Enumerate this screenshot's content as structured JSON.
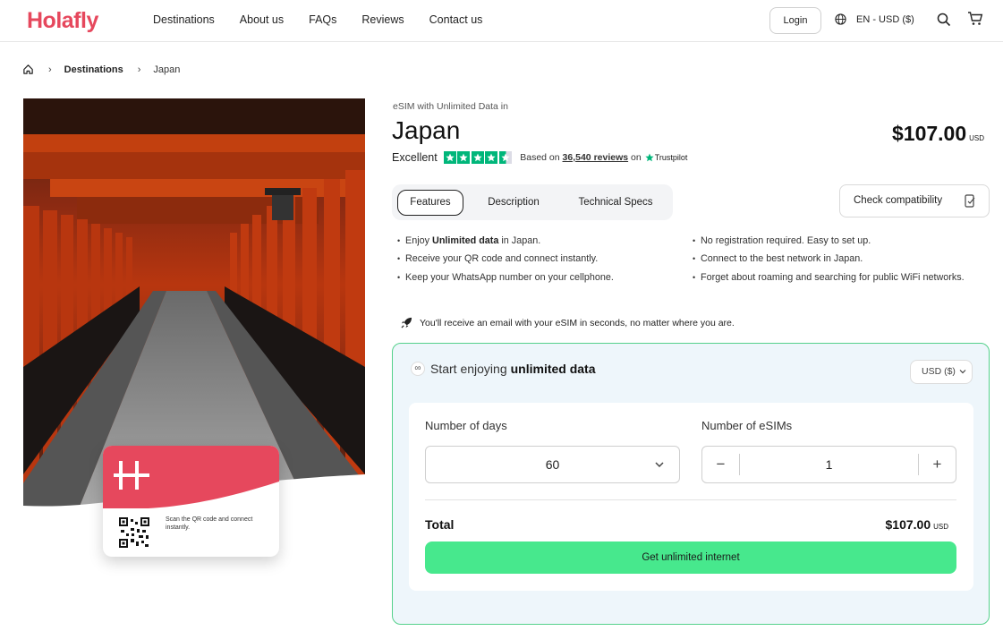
{
  "header": {
    "logo": "Holafly",
    "nav": [
      "Destinations",
      "About us",
      "FAQs",
      "Reviews",
      "Contact us"
    ],
    "login_label": "Login",
    "language": "EN - USD ($)"
  },
  "breadcrumb": {
    "items": [
      "Destinations",
      "Japan"
    ]
  },
  "card": {
    "text": "Scan the QR code and connect instantly."
  },
  "product": {
    "subtitle": "eSIM with Unlimited Data in",
    "title": "Japan",
    "price": "$107.00",
    "currency": "USD",
    "rating_label": "Excellent",
    "rating_stars": 4.5,
    "reviews_prefix": "Based on",
    "reviews_count": "36,540 reviews",
    "reviews_suffix": "on",
    "trustpilot": "Trustpilot"
  },
  "tabs": [
    "Features",
    "Description",
    "Technical Specs"
  ],
  "compat_label": "Check compatibility",
  "features_left": [
    {
      "pre": "Enjoy ",
      "bold": "Unlimited data",
      "post": " in Japan."
    },
    {
      "pre": "Receive your QR code and connect instantly.",
      "bold": "",
      "post": ""
    },
    {
      "pre": "Keep your WhatsApp number on your cellphone.",
      "bold": "",
      "post": ""
    }
  ],
  "features_right": [
    "No registration required. Easy to set up.",
    "Connect to the best network in Japan.",
    "Forget about roaming and searching for public WiFi networks."
  ],
  "notice": "You'll receive an email with your eSIM in seconds, no matter where you are.",
  "plan": {
    "head_pre": "Start enjoying",
    "head_bold": "unlimited data",
    "currency_select": "USD ($)",
    "days_label": "Number of days",
    "days_value": "60",
    "esims_label": "Number of eSIMs",
    "esims_value": "1",
    "total_label": "Total",
    "total_value": "$107.00",
    "total_currency": "USD",
    "cta": "Get unlimited internet"
  },
  "colors": {
    "brand": "#e6485d",
    "cta": "#47e88d",
    "trustpilot": "#00b67a",
    "plan_border": "#55d18b",
    "plan_bg": "#eef6fb"
  }
}
